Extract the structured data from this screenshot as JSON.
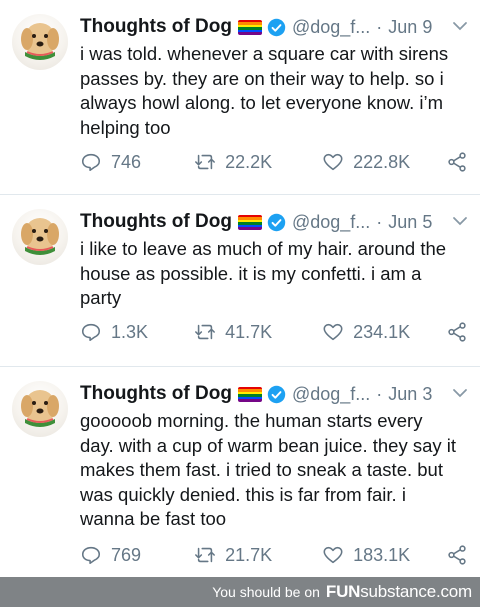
{
  "colors": {
    "text": "#14171a",
    "muted": "#657786",
    "verified": "#1da1f2",
    "divider": "#e1e8ed",
    "footer_bg": "#7f8386"
  },
  "tweets": [
    {
      "author": "Thoughts of Dog",
      "handle": "@dog_f...",
      "separator": "·",
      "date": "Jun 9",
      "text": "i was told. whenever a square car with sirens passes by. they are on their way to help. so i always howl along. to let everyone know. i’m helping too",
      "replies": "746",
      "retweets": "22.2K",
      "likes": "222.8K"
    },
    {
      "author": "Thoughts of Dog",
      "handle": "@dog_f...",
      "separator": "·",
      "date": "Jun 5",
      "text": "i like to leave as much of my hair. around the house as possible. it is my confetti. i am a party",
      "replies": "1.3K",
      "retweets": "41.7K",
      "likes": "234.1K"
    },
    {
      "author": "Thoughts of Dog",
      "handle": "@dog_f...",
      "separator": "·",
      "date": "Jun 3",
      "text": "gooooob morning. the human starts every day. with a cup of warm bean juice. they say it makes them fast. i tried to sneak a taste. but was quickly denied. this is far from fair. i wanna be fast too",
      "replies": "769",
      "retweets": "21.7K",
      "likes": "183.1K"
    }
  ],
  "icons": {
    "reply": "reply-icon",
    "retweet": "retweet-icon",
    "like": "heart-icon",
    "share": "share-icon",
    "verified": "verified-badge-icon",
    "flag": "rainbow-flag-icon",
    "menu": "chevron-down-icon"
  },
  "footer": {
    "note": "You should be on",
    "brand_bold": "FUN",
    "brand_rest": "substance",
    "brand_suffix": ".com"
  }
}
